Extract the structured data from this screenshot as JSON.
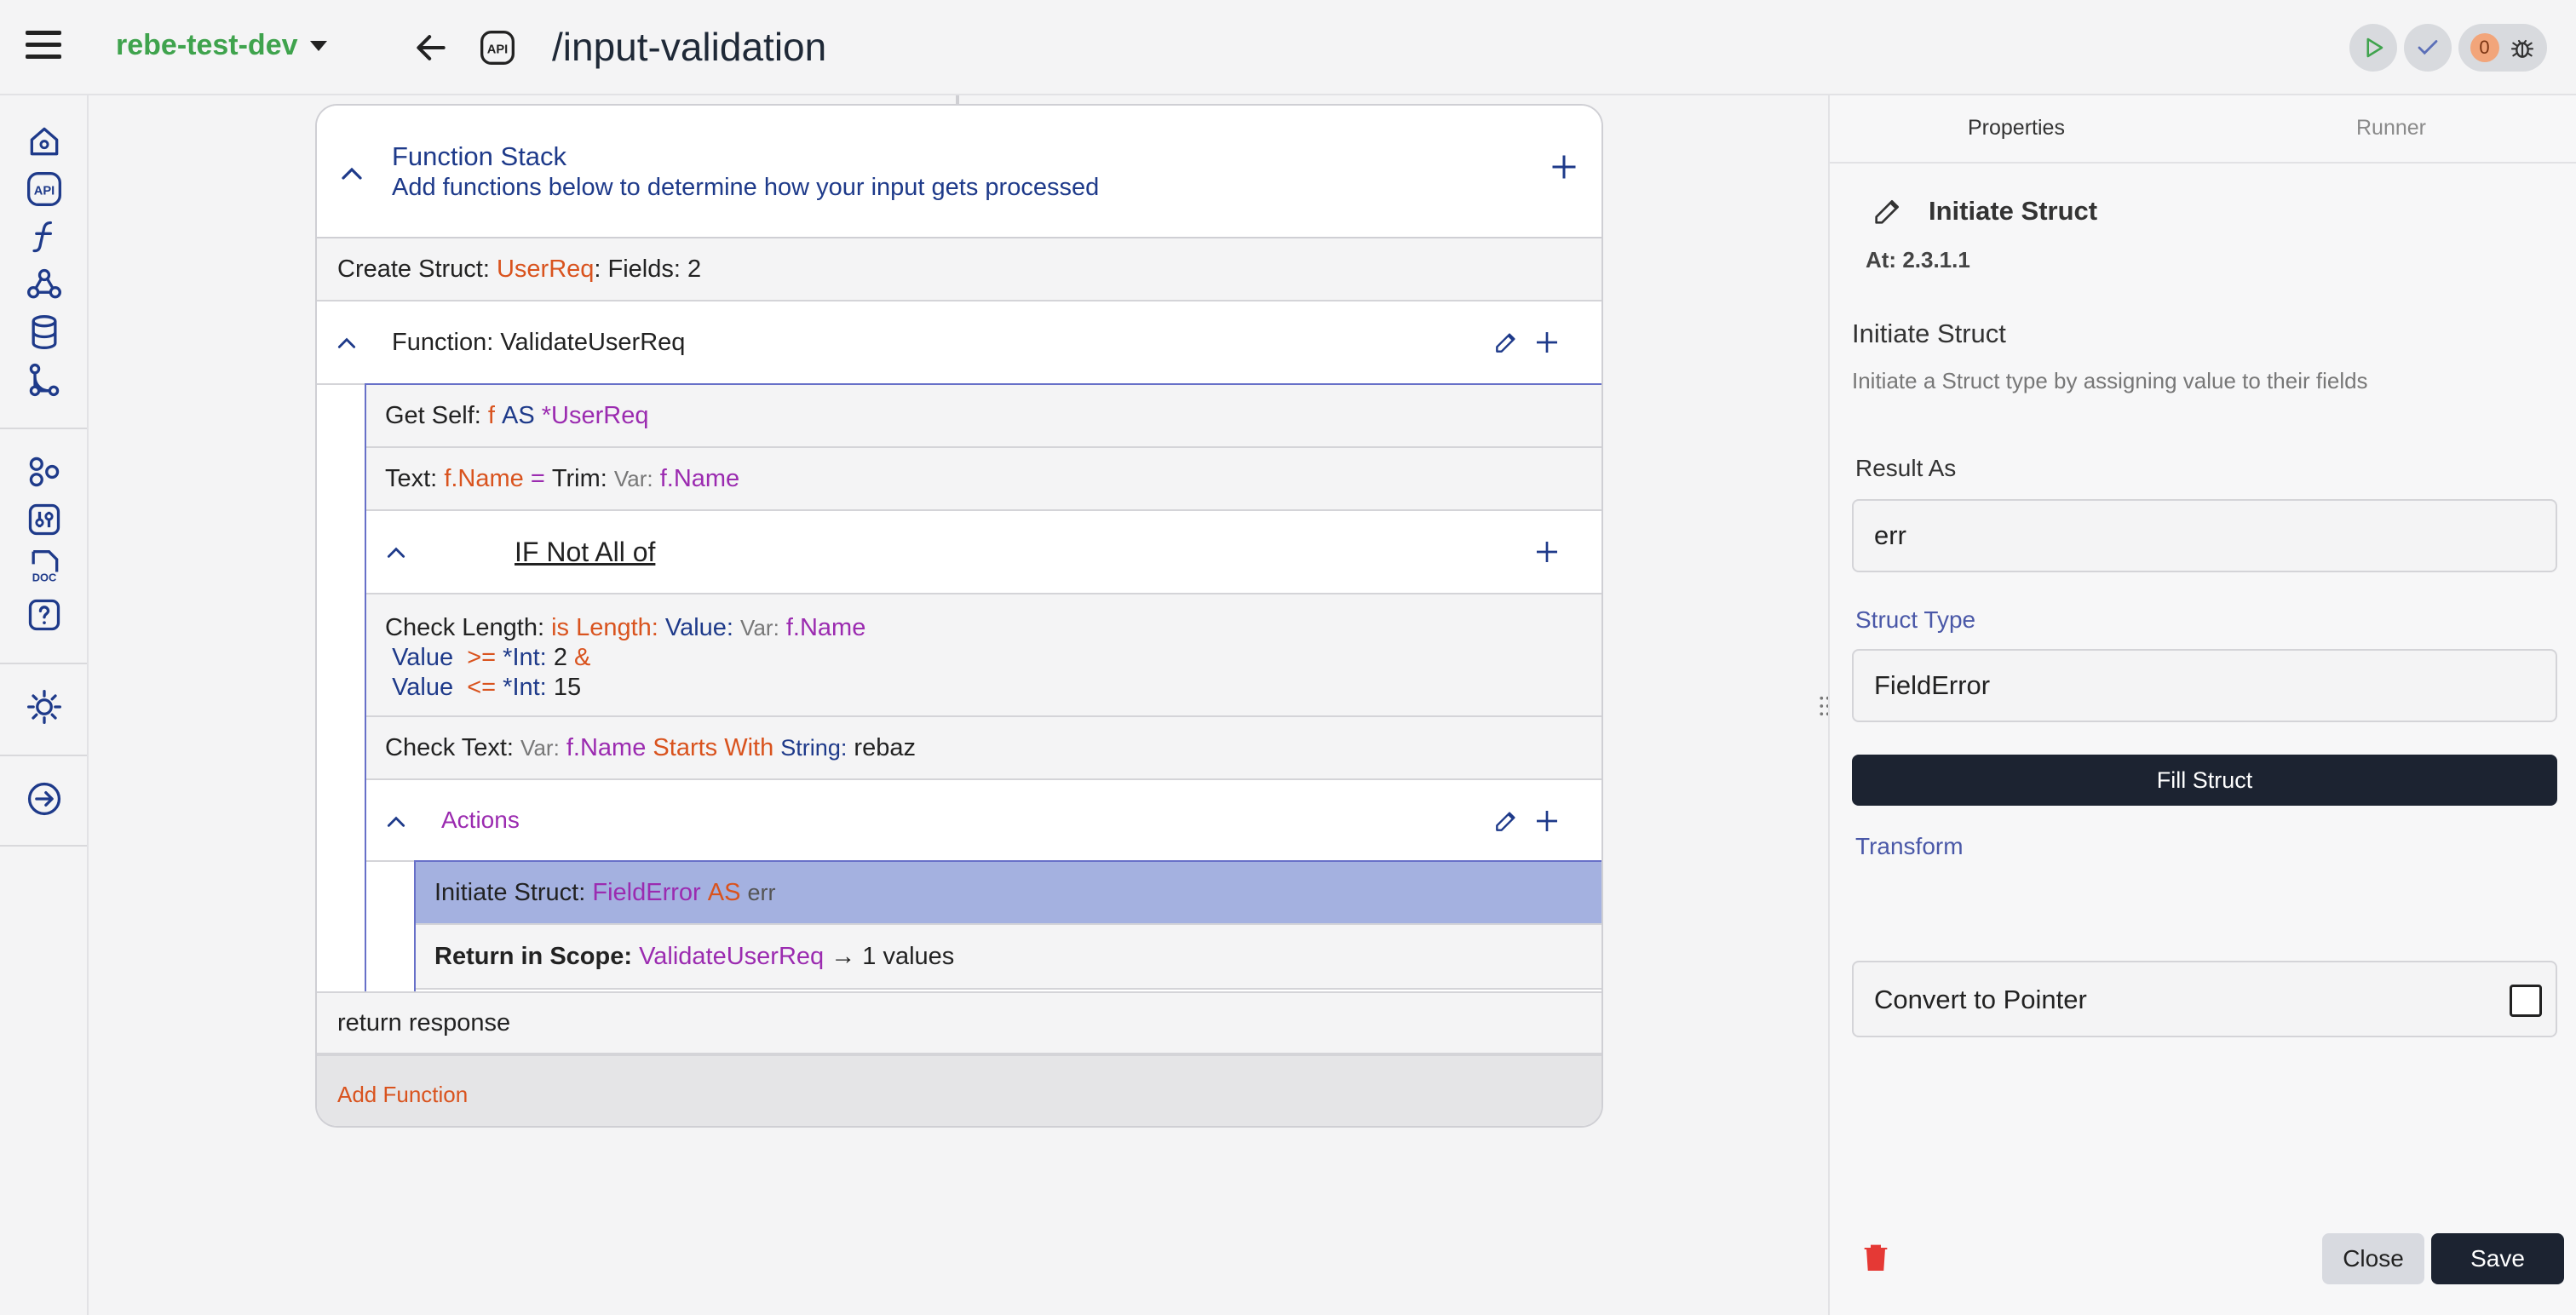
{
  "topbar": {
    "workspace": "rebe-test-dev",
    "route": "/input-validation",
    "error_count": "0"
  },
  "icons": {
    "menu": "hamburger-icon",
    "back": "arrow-left-icon",
    "api": "api-icon",
    "run": "play-icon",
    "check": "check-icon",
    "debug": "bug-icon"
  },
  "rail": [
    "home-icon",
    "api-icon",
    "function-icon",
    "webhook-icon",
    "database-icon",
    "git-branch-icon",
    "components-icon",
    "tools-icon",
    "doc-icon",
    "help-icon",
    "theme-icon",
    "logout-icon"
  ],
  "stack": {
    "title": "Function Stack",
    "subtitle": "Add functions below to determine how your input gets processed",
    "create_struct": {
      "prefix": "Create Struct:",
      "name": "UserReq",
      "suffix": ": Fields: 2"
    },
    "function": {
      "label": "Function: ValidateUserReq"
    },
    "get_self": {
      "prefix": "Get Self:",
      "var": "f",
      "as": "AS",
      "type": "*UserReq"
    },
    "text_row": {
      "prefix": "Text:",
      "target": "f.Name",
      "eq": "=",
      "fn": "Trim:",
      "var_label": "Var:",
      "var": "f.Name"
    },
    "if_block": {
      "label": "IF Not All of"
    },
    "check_length": {
      "prefix": "Check Length:",
      "op": "is Length:",
      "value_label": "Value:",
      "var_label": "Var:",
      "var": "f.Name",
      "line2_value": "Value",
      "line2_op": ">=",
      "line2_type": "*Int:",
      "line2_num": "2",
      "line2_join": "&",
      "line3_value": "Value",
      "line3_op": "<=",
      "line3_type": "*Int:",
      "line3_num": "15"
    },
    "check_text": {
      "prefix": "Check Text:",
      "var_label": "Var:",
      "var": "f.Name",
      "op": "Starts With",
      "type": "String:",
      "value": "rebaz"
    },
    "actions": {
      "label": "Actions"
    },
    "initiate": {
      "prefix": "Initiate Struct:",
      "type": "FieldError",
      "as": "AS",
      "name": "err"
    },
    "return_scope": {
      "prefix": "Return in Scope:",
      "fn": "ValidateUserReq",
      "suffix": "→ 1 values"
    },
    "return_response": "return response",
    "add_function": "Add Function"
  },
  "panel": {
    "tabs": [
      "Properties",
      "Runner"
    ],
    "title": "Initiate Struct",
    "at": "At: 2.3.1.1",
    "name": "Initiate Struct",
    "description": "Initiate a Struct type by assigning value to their fields",
    "result_as_label": "Result As",
    "result_as_value": "err",
    "struct_type_label": "Struct Type",
    "struct_type_value": "FieldError",
    "fill_button": "Fill Struct",
    "transform_label": "Transform",
    "pointer_label": "Convert to Pointer",
    "close": "Close",
    "save": "Save"
  },
  "colors": {
    "workspace": "#3fa34d",
    "orange": "#d9531e",
    "purple": "#9b2bb0",
    "navy": "#1e3a8a",
    "selected": "#a4b1e0",
    "dark_button": "#1c2331",
    "delete": "#e53935"
  }
}
